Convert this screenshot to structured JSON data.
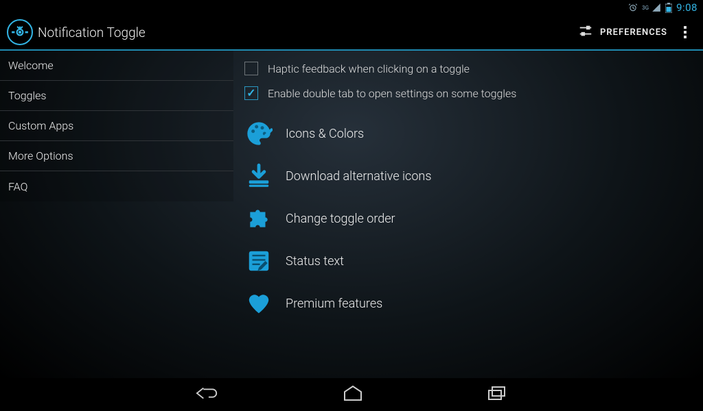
{
  "statusbar": {
    "network_label": "3G",
    "time": "9:08"
  },
  "actionbar": {
    "title": "Notification Toggle",
    "preferences_label": "PREFERENCES"
  },
  "sidebar": {
    "items": [
      {
        "label": "Welcome"
      },
      {
        "label": "Toggles"
      },
      {
        "label": "Custom Apps"
      },
      {
        "label": "More Options"
      },
      {
        "label": "FAQ"
      }
    ]
  },
  "content": {
    "checkboxes": [
      {
        "label": "Haptic feedback when clicking on a toggle",
        "checked": false
      },
      {
        "label": "Enable double tab to open settings on some toggles",
        "checked": true
      }
    ],
    "options": [
      {
        "label": "Icons & Colors",
        "icon": "palette-icon"
      },
      {
        "label": "Download alternative icons",
        "icon": "download-icon"
      },
      {
        "label": "Change toggle order",
        "icon": "puzzle-icon"
      },
      {
        "label": "Status text",
        "icon": "edit-note-icon"
      },
      {
        "label": "Premium features",
        "icon": "heart-icon"
      }
    ]
  }
}
